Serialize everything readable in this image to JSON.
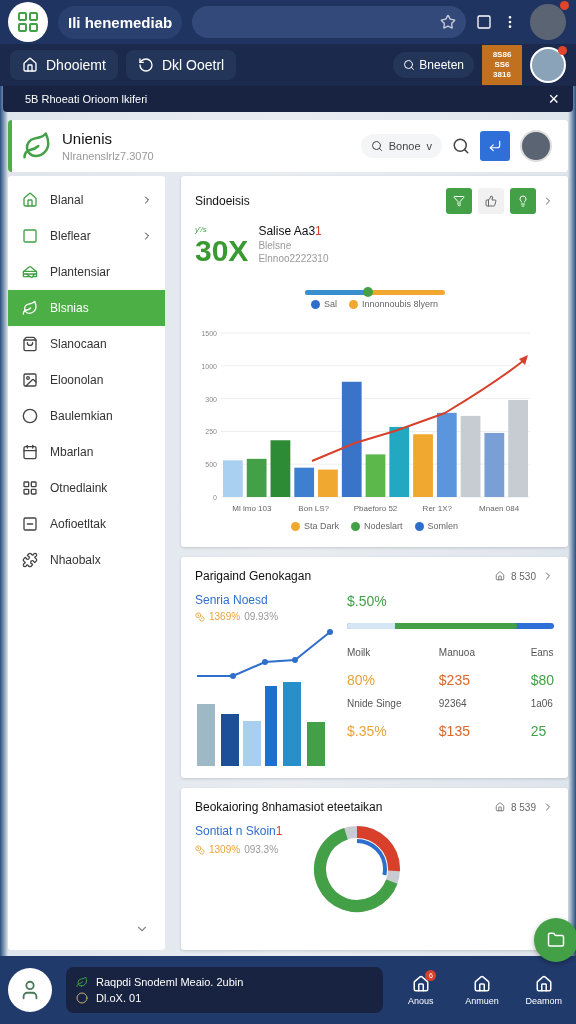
{
  "top_bar": {
    "title": "Ili henemediab"
  },
  "nav_tabs": [
    {
      "label": "Dhooiemt",
      "kind": "home"
    },
    {
      "label": "Dkl Ooetrl",
      "kind": "refresh"
    }
  ],
  "search_pill": {
    "label": "Bneeten"
  },
  "price_tile": {
    "lines": [
      "8S86",
      "SS6",
      "3816"
    ]
  },
  "banner": {
    "text": "5B Rhoeati Orioom lkiferi",
    "close": "×"
  },
  "header": {
    "title": "Unienis",
    "subtitle": "Nlranenslrlz7.3070",
    "filter": {
      "label": "Bonoe",
      "caret": "v"
    }
  },
  "sidebar": {
    "items": [
      {
        "label": "Blanal",
        "chevron": true,
        "selected": false
      },
      {
        "label": "Bleflear",
        "chevron": true,
        "selected": false
      },
      {
        "label": "Plantensiar",
        "chevron": false,
        "selected": false
      },
      {
        "label": "Blsnias",
        "chevron": false,
        "selected": true
      },
      {
        "label": "Slanocaan",
        "chevron": false,
        "selected": false
      },
      {
        "label": "Eloonolan",
        "chevron": false,
        "selected": false
      },
      {
        "label": "Baulemkian",
        "chevron": false,
        "selected": false
      },
      {
        "label": "Mbarlan",
        "chevron": false,
        "selected": false
      },
      {
        "label": "Otnedlaink",
        "chevron": false,
        "selected": false
      },
      {
        "label": "Aofioetltak",
        "chevron": false,
        "selected": false
      },
      {
        "label": "Nhaobalx",
        "chevron": false,
        "selected": false
      }
    ]
  },
  "sales_card": {
    "title": "Sindoeisis",
    "kpi": {
      "small": "ƴ /s",
      "value": "30X",
      "name": "Salise Aa3",
      "mark": "1",
      "line_2": "Blelsne",
      "line_3": "Elnnoo2222310"
    },
    "range": {
      "level": 0.45
    },
    "legend_top": [
      {
        "label": "Sal",
        "color": "#2f6fcc"
      },
      {
        "label": "Innonnoubis 8lyern",
        "color": "#f0a830"
      }
    ],
    "axis_labels": [
      "1500",
      "1000",
      "300",
      "250",
      "500",
      "0"
    ],
    "category_labels": [
      "Ml lmo 103",
      "Bon LS?",
      "Pbaeforo 52",
      "Rer 1X?",
      "Mnaen 084"
    ],
    "legend_bottom": [
      {
        "label": "Sta Dark",
        "color": "#f0a830"
      },
      {
        "label": "Nodeslart",
        "color": "#43a047"
      },
      {
        "label": "Somlen",
        "color": "#2f6fcc"
      }
    ]
  },
  "growth_card": {
    "title": "Parigaind Genokagan",
    "meta": "8 530",
    "subtitle": "Senria Noesd",
    "stat": "1369%",
    "stat_2": "09.93%",
    "headline": "$.50%",
    "progress": {
      "level": 0.82
    },
    "metrics": [
      {
        "label": "Moilk",
        "value": "80%",
        "color": "#e8a23a"
      },
      {
        "label": "Manuoa",
        "value": "$235",
        "color": "#d8662a"
      },
      {
        "label": "Eans",
        "value": "$80",
        "color": "#43a047"
      },
      {
        "label": "Nnide Singe",
        "value": "$.35%",
        "color": "#e8a23a"
      },
      {
        "label": "92364",
        "value": "$135",
        "color": "#d8662a"
      },
      {
        "label": "1a06",
        "value": "25",
        "color": "#43a047"
      }
    ]
  },
  "donut_card": {
    "title": "Beokaioring 8nhamasiot eteetaikan",
    "meta": "8 539",
    "subtitle": "Sontiat n Skoin",
    "mark": "1",
    "stat": "1309%",
    "stat_2": "093.3%"
  },
  "bottom_bar": {
    "line_1": "Raqpdi Snodeml Meaio. 2ubin",
    "line_2": "Dl.oX. 01",
    "nav": [
      {
        "label": "Anous",
        "badge": "6"
      },
      {
        "label": "Anmuen"
      },
      {
        "label": "Deamom"
      }
    ]
  }
}
